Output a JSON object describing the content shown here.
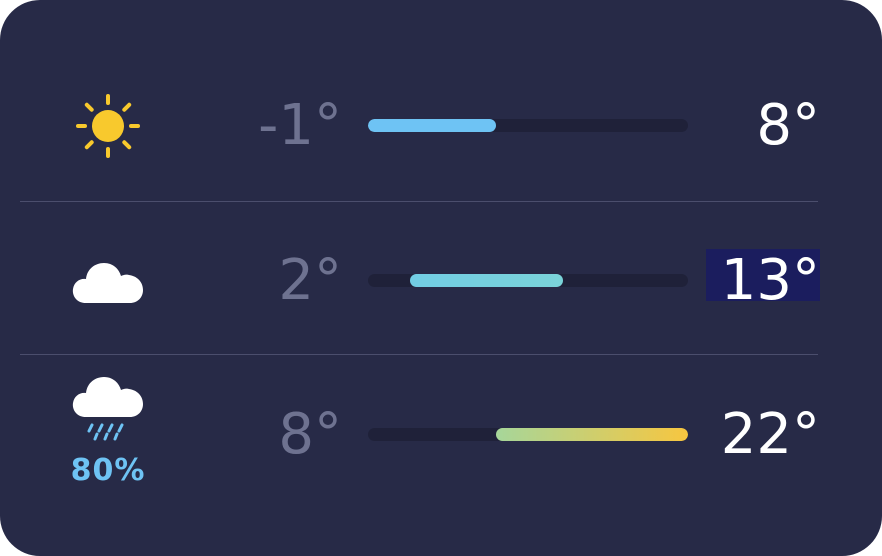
{
  "forecast": [
    {
      "icon": "sun-icon",
      "low": "-1°",
      "high": "8°",
      "range_start": 0.0,
      "range_end": 0.4,
      "colors": [
        "#6ec3f4",
        "#6ec3f4"
      ],
      "selected": false
    },
    {
      "icon": "cloud-icon",
      "low": "2°",
      "high": "13°",
      "range_start": 0.13,
      "range_end": 0.61,
      "colors": [
        "#72cde4",
        "#7ad3d9"
      ],
      "selected": true
    },
    {
      "icon": "rain-cloud-icon",
      "precip": "80%",
      "low": "8°",
      "high": "22°",
      "range_start": 0.4,
      "range_end": 1.0,
      "colors": [
        "#a6d69a",
        "#f7c640"
      ],
      "selected": false
    }
  ]
}
